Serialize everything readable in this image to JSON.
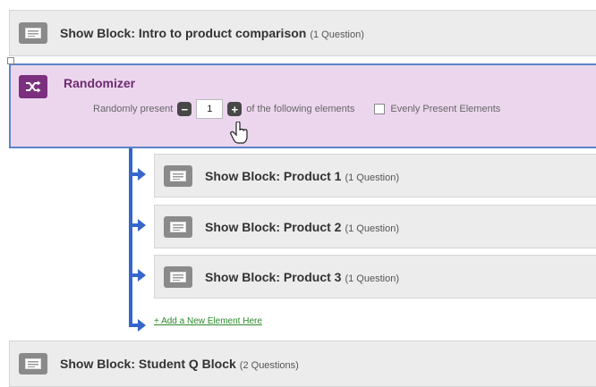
{
  "blocks": {
    "intro": {
      "title": "Show Block: Intro to product comparison",
      "count": "(1 Question)"
    },
    "product1": {
      "title": "Show Block: Product 1",
      "count": "(1 Question)"
    },
    "product2": {
      "title": "Show Block: Product 2",
      "count": "(1 Question)"
    },
    "product3": {
      "title": "Show Block: Product 3",
      "count": "(1 Question)"
    },
    "student": {
      "title": "Show Block: Student Q Block",
      "count": "(2 Questions)"
    }
  },
  "randomizer": {
    "title": "Randomizer",
    "present_label": "Randomly present",
    "present_value": "1",
    "following_label": "of the following elements",
    "evenly_label": "Evenly Present Elements"
  },
  "add_element_link": "+ Add a New Element Here",
  "colors": {
    "randomizer_bg": "#ecd6ee",
    "randomizer_border": "#5b84c8",
    "randomizer_title": "#6d2b70",
    "connector": "#3466cc",
    "add_link": "#2a8a2a"
  },
  "icons": {
    "block": "block-icon",
    "randomizer": "shuffle-icon",
    "cursor": "hand-cursor-icon"
  }
}
